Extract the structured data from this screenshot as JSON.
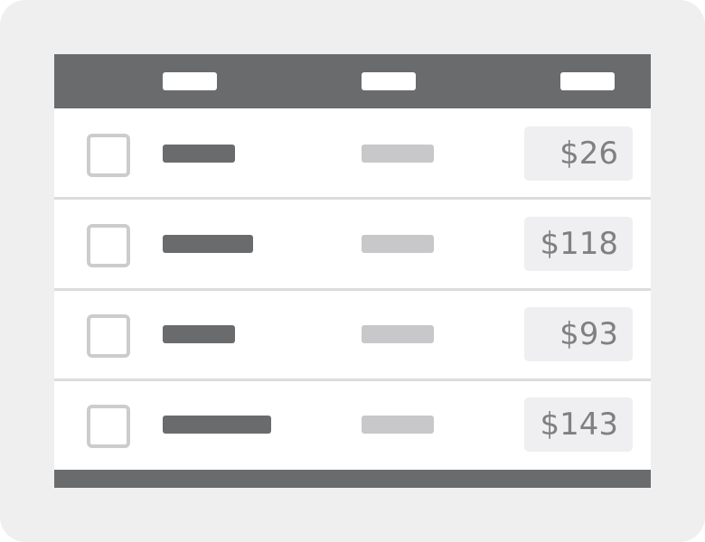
{
  "table": {
    "columns": [
      "",
      "",
      ""
    ],
    "rows": [
      {
        "checked": false,
        "price": "$26"
      },
      {
        "checked": false,
        "price": "$118"
      },
      {
        "checked": false,
        "price": "$93"
      },
      {
        "checked": false,
        "price": "$143"
      }
    ]
  },
  "colors": {
    "header": "#6a6b6d",
    "background": "#efefef",
    "checkbox_border": "#cccccc",
    "placeholder_dark": "#6a6b6d",
    "placeholder_light": "#c8c8ca",
    "price_bg": "#efeef0",
    "price_text": "#808083"
  }
}
